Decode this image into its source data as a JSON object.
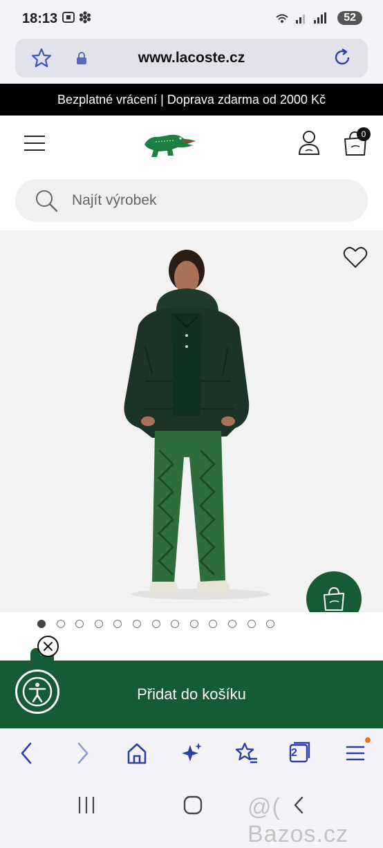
{
  "status_bar": {
    "time": "18:13",
    "battery": "52"
  },
  "url_bar": {
    "url": "www.lacoste.cz"
  },
  "promo": {
    "text": "Bezplatné vrácení | Doprava zdarma od 2000 Kč"
  },
  "header": {
    "cart_count": "0"
  },
  "search": {
    "placeholder": "Najít výrobek"
  },
  "product": {
    "image_count": 13,
    "active_image": 1
  },
  "cart_bar": {
    "label": "Přidat do košíku"
  },
  "browser_toolbar": {
    "tabs_count": "2"
  },
  "watermark": {
    "text": "@( Bazos.cz"
  },
  "colors": {
    "brand_green": "#155b33",
    "browser_accent": "#2b3fa6",
    "promo_black": "#000000"
  }
}
